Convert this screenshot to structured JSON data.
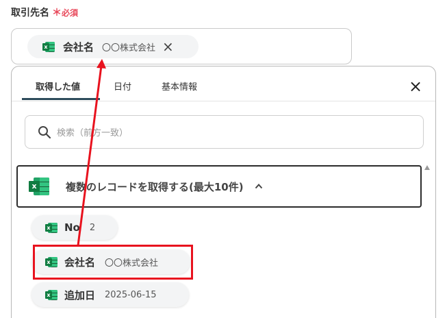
{
  "field": {
    "label": "取引先名",
    "required_star": "＊",
    "required_text": "必須"
  },
  "token": {
    "name": "会社名",
    "value": "〇〇株式会社",
    "close": "×"
  },
  "popup": {
    "tabs": [
      {
        "label": "取得した値"
      },
      {
        "label": "日付"
      },
      {
        "label": "基本情報"
      }
    ],
    "close": "×",
    "search": {
      "placeholder": "検索（前方一致）"
    },
    "group": {
      "title": "複数のレコードを取得する(最大10件)"
    },
    "items": [
      {
        "name": "No",
        "value": "2"
      },
      {
        "name": "会社名",
        "value": "〇〇株式会社"
      },
      {
        "name": "追加日",
        "value": "2025-06-15"
      }
    ]
  },
  "colors": {
    "accent_red": "#e8121e",
    "required": "#e8495b",
    "excel_green": "#107c41",
    "tab_underline": "#2d4b5b"
  },
  "icons": [
    "excel-icon",
    "close-icon",
    "search-icon",
    "chevron-up-icon"
  ]
}
